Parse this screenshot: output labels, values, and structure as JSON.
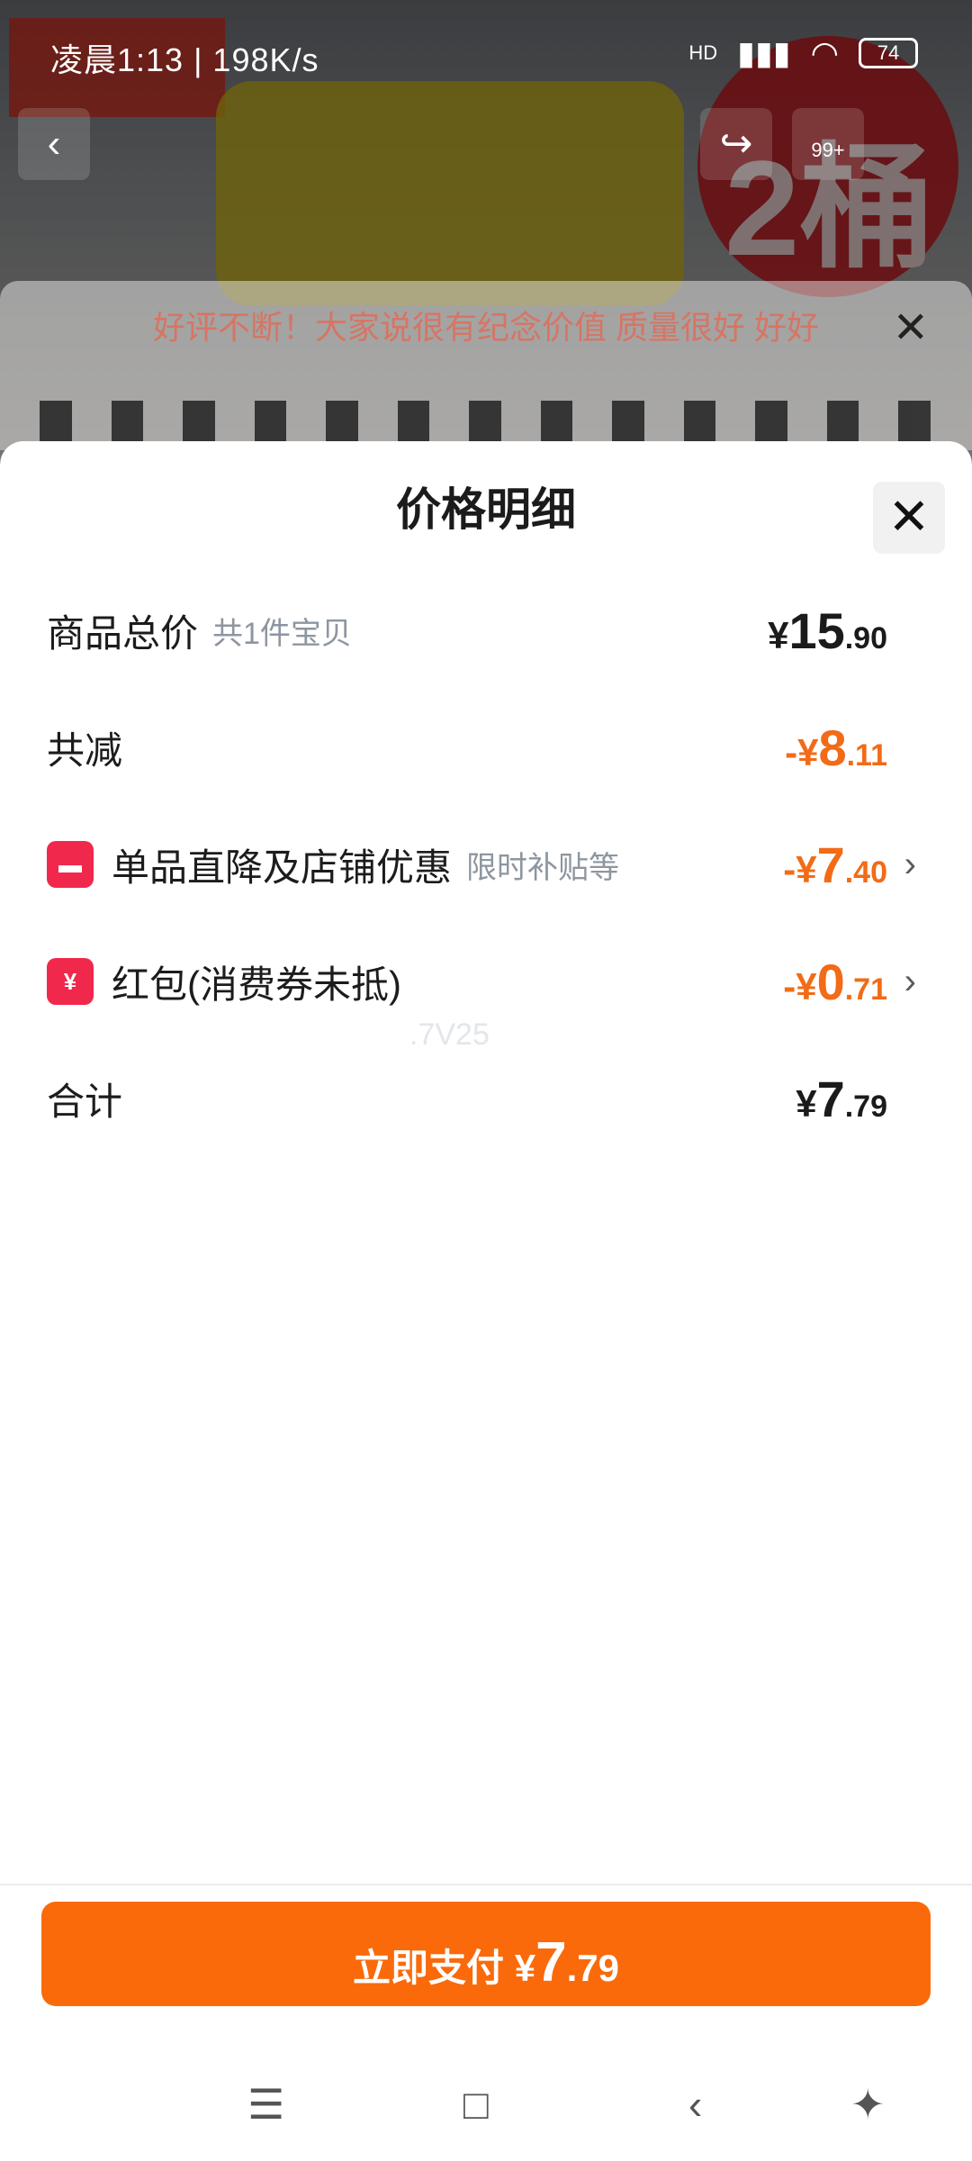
{
  "status_bar": {
    "time": "凌晨1:13 | 198K/s",
    "network": "HD",
    "battery": "74"
  },
  "background": {
    "banner_text": "2桶",
    "marquee_text": "好评不断！大家说很有纪念价值 质量很好 好好",
    "cart_badge": "99+"
  },
  "sheet": {
    "title": "价格明细",
    "rows": [
      {
        "label": "商品总价",
        "note": "共1件宝贝",
        "price_prefix": "¥",
        "price_int": "15",
        "price_dec": ".90"
      },
      {
        "label": "共减",
        "note": "",
        "price_prefix": "-¥",
        "price_int": "8",
        "price_dec": ".11"
      },
      {
        "label": "单品直降及店铺优惠",
        "note": "限时补贴等",
        "price_prefix": "-¥",
        "price_int": "7",
        "price_dec": ".40"
      },
      {
        "label": "红包(消费券未抵)",
        "note": "",
        "price_prefix": "-¥",
        "price_int": "0",
        "price_dec": ".71"
      },
      {
        "label": "合计",
        "note": "",
        "price_prefix": "¥",
        "price_int": "7",
        "price_dec": ".79"
      }
    ],
    "faint_text": ".7V25"
  },
  "pay_button": {
    "label": "立即支付",
    "currency": "¥",
    "price_int": "7",
    "price_dec": ".79"
  },
  "colors": {
    "accent": "#fa6a0a",
    "discount": "#f26b16",
    "badge": "#f0284c"
  }
}
